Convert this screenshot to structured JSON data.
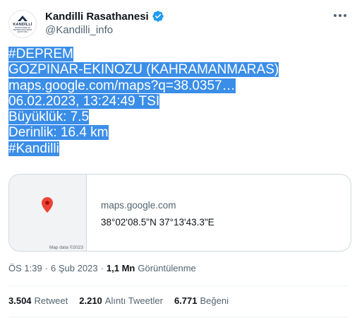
{
  "author": {
    "display_name": "Kandilli Rasathanesi",
    "handle": "@Kandilli_info",
    "avatar_title": "KANDİLLİ",
    "avatar_subtitle": "RASATHANESİ VE DEPREM ARAŞTIRMA ENSTİTÜSÜ",
    "verified_icon": "verified-badge-icon",
    "more_icon": "more-options-icon"
  },
  "colors": {
    "verified": "#1d9bf0",
    "highlight": "#3b8ee8",
    "map_pin": "#ea4335",
    "secondary_text": "#536471"
  },
  "tweet": {
    "lines": [
      "#DEPREM",
      "GOZPINAR-EKINOZU (KAHRAMANMARAS)",
      "maps.google.com/maps?q=38.0357…",
      "06.02.2023, 13:24:49 TSİ",
      "Büyüklük: 7.5",
      "Derinlik: 16.4 km",
      "#Kandilli"
    ]
  },
  "card": {
    "domain": "maps.google.com",
    "coordinates": "38°02'08.5\"N 37°13'43.3\"E",
    "map_credit": "Map data ©2023",
    "pin_icon": "map-pin-icon"
  },
  "meta": {
    "time": "ÖS 1:39",
    "separator": "·",
    "date": "6 Şub 2023",
    "views_count": "1,1 Mn",
    "views_label": "Görüntülenme"
  },
  "stats": {
    "retweets_count": "3.504",
    "retweets_label": "Retweet",
    "quotes_count": "2.210",
    "quotes_label": "Alıntı Tweetler",
    "likes_count": "6.771",
    "likes_label": "Beğeni"
  }
}
